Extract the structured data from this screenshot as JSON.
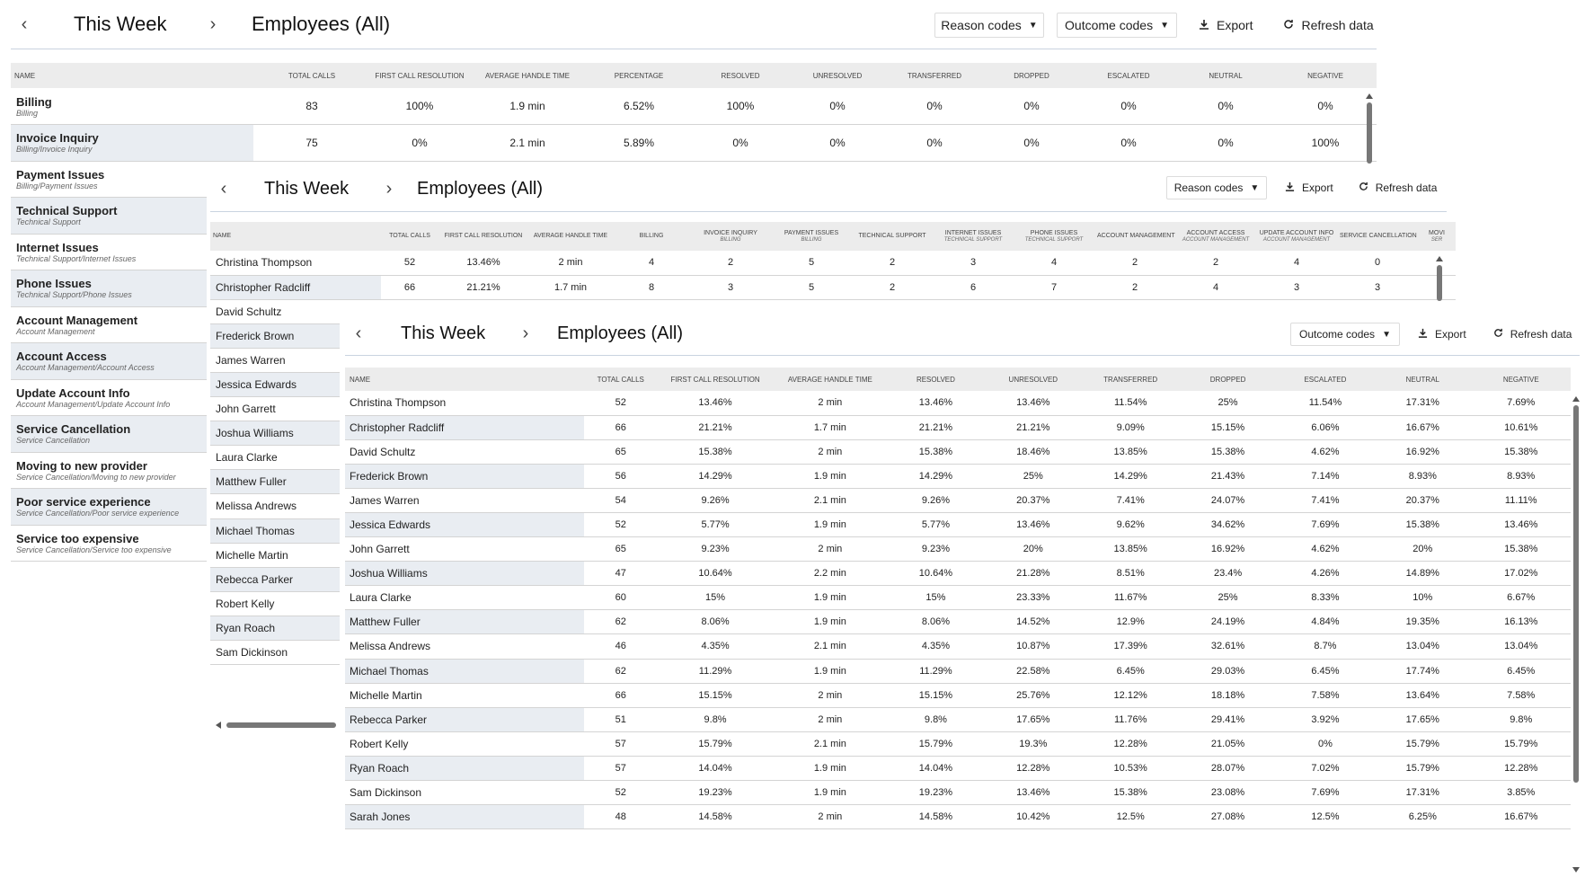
{
  "nav": {
    "prev": "‹",
    "next": "›"
  },
  "panel1": {
    "period": "This Week",
    "scope": "Employees (All)",
    "toolbar": {
      "reason_codes": "Reason codes",
      "outcome_codes": "Outcome codes",
      "export": "Export",
      "refresh": "Refresh data"
    },
    "columns": [
      "Name",
      "Total calls",
      "First call resolution",
      "Average handle time",
      "Percentage",
      "Resolved",
      "Unresolved",
      "Transferred",
      "Dropped",
      "Escalated",
      "Neutral",
      "Negative"
    ],
    "rows": [
      {
        "name": "Billing",
        "path": "Billing",
        "cells": [
          "83",
          "100%",
          "1.9 min",
          "6.52%",
          "100%",
          "0%",
          "0%",
          "0%",
          "0%",
          "0%",
          "0%"
        ]
      },
      {
        "name": "Invoice Inquiry",
        "path": "Billing/Invoice Inquiry",
        "cells": [
          "75",
          "0%",
          "2.1 min",
          "5.89%",
          "0%",
          "0%",
          "0%",
          "0%",
          "0%",
          "0%",
          "100%"
        ]
      },
      {
        "name": "Payment Issues",
        "path": "Billing/Payment Issues",
        "cells": []
      },
      {
        "name": "Technical Support",
        "path": "Technical Support",
        "cells": []
      },
      {
        "name": "Internet Issues",
        "path": "Technical Support/Internet Issues",
        "cells": []
      },
      {
        "name": "Phone Issues",
        "path": "Technical Support/Phone Issues",
        "cells": []
      },
      {
        "name": "Account Management",
        "path": "Account Management",
        "cells": []
      },
      {
        "name": "Account Access",
        "path": "Account Management/Account Access",
        "cells": []
      },
      {
        "name": "Update Account Info",
        "path": "Account Management/Update Account Info",
        "cells": []
      },
      {
        "name": "Service Cancellation",
        "path": "Service Cancellation",
        "cells": []
      },
      {
        "name": "Moving to new provider",
        "path": "Service Cancellation/Moving to new provider",
        "cells": []
      },
      {
        "name": "Poor service experience",
        "path": "Service Cancellation/Poor service experience",
        "cells": []
      },
      {
        "name": "Service too expensive",
        "path": "Service Cancellation/Service too expensive",
        "cells": []
      }
    ]
  },
  "panel2": {
    "period": "This Week",
    "scope": "Employees (All)",
    "toolbar": {
      "reason_codes": "Reason codes",
      "export": "Export",
      "refresh": "Refresh data"
    },
    "columns": [
      {
        "label": "Name",
        "sub": ""
      },
      {
        "label": "Total calls",
        "sub": ""
      },
      {
        "label": "First call resolution",
        "sub": ""
      },
      {
        "label": "Average handle time",
        "sub": ""
      },
      {
        "label": "Billing",
        "sub": ""
      },
      {
        "label": "Invoice Inquiry",
        "sub": "Billing"
      },
      {
        "label": "Payment Issues",
        "sub": "Billing"
      },
      {
        "label": "Technical Support",
        "sub": ""
      },
      {
        "label": "Internet Issues",
        "sub": "Technical Support"
      },
      {
        "label": "Phone Issues",
        "sub": "Technical Support"
      },
      {
        "label": "Account Management",
        "sub": ""
      },
      {
        "label": "Account Access",
        "sub": "Account Management"
      },
      {
        "label": "Update Account Info",
        "sub": "Account Management"
      },
      {
        "label": "Service Cancellation",
        "sub": ""
      },
      {
        "label": "Movi",
        "sub": "Ser"
      }
    ],
    "rows": [
      {
        "name": "Christina Thompson",
        "cells": [
          "52",
          "13.46%",
          "2 min",
          "4",
          "2",
          "5",
          "2",
          "3",
          "4",
          "2",
          "2",
          "4",
          "0",
          ""
        ]
      },
      {
        "name": "Christopher Radcliff",
        "cells": [
          "66",
          "21.21%",
          "1.7 min",
          "8",
          "3",
          "5",
          "2",
          "6",
          "7",
          "2",
          "4",
          "3",
          "3",
          ""
        ]
      },
      {
        "name": "David Schultz",
        "cells": []
      },
      {
        "name": "Frederick Brown",
        "cells": []
      },
      {
        "name": "James Warren",
        "cells": []
      },
      {
        "name": "Jessica Edwards",
        "cells": []
      },
      {
        "name": "John Garrett",
        "cells": []
      },
      {
        "name": "Joshua Williams",
        "cells": []
      },
      {
        "name": "Laura Clarke",
        "cells": []
      },
      {
        "name": "Matthew Fuller",
        "cells": []
      },
      {
        "name": "Melissa Andrews",
        "cells": []
      },
      {
        "name": "Michael Thomas",
        "cells": []
      },
      {
        "name": "Michelle Martin",
        "cells": []
      },
      {
        "name": "Rebecca Parker",
        "cells": []
      },
      {
        "name": "Robert Kelly",
        "cells": []
      },
      {
        "name": "Ryan Roach",
        "cells": []
      },
      {
        "name": "Sam Dickinson",
        "cells": []
      }
    ]
  },
  "panel3": {
    "period": "This Week",
    "scope": "Employees (All)",
    "toolbar": {
      "outcome_codes": "Outcome codes",
      "export": "Export",
      "refresh": "Refresh data"
    },
    "columns": [
      "Name",
      "Total calls",
      "First call resolution",
      "Average handle time",
      "Resolved",
      "Unresolved",
      "Transferred",
      "Dropped",
      "Escalated",
      "Neutral",
      "Negative"
    ],
    "rows": [
      {
        "name": "Christina Thompson",
        "cells": [
          "52",
          "13.46%",
          "2 min",
          "13.46%",
          "13.46%",
          "11.54%",
          "25%",
          "11.54%",
          "17.31%",
          "7.69%"
        ]
      },
      {
        "name": "Christopher Radcliff",
        "cells": [
          "66",
          "21.21%",
          "1.7 min",
          "21.21%",
          "21.21%",
          "9.09%",
          "15.15%",
          "6.06%",
          "16.67%",
          "10.61%"
        ]
      },
      {
        "name": "David Schultz",
        "cells": [
          "65",
          "15.38%",
          "2 min",
          "15.38%",
          "18.46%",
          "13.85%",
          "15.38%",
          "4.62%",
          "16.92%",
          "15.38%"
        ]
      },
      {
        "name": "Frederick Brown",
        "cells": [
          "56",
          "14.29%",
          "1.9 min",
          "14.29%",
          "25%",
          "14.29%",
          "21.43%",
          "7.14%",
          "8.93%",
          "8.93%"
        ]
      },
      {
        "name": "James Warren",
        "cells": [
          "54",
          "9.26%",
          "2.1 min",
          "9.26%",
          "20.37%",
          "7.41%",
          "24.07%",
          "7.41%",
          "20.37%",
          "11.11%"
        ]
      },
      {
        "name": "Jessica Edwards",
        "cells": [
          "52",
          "5.77%",
          "1.9 min",
          "5.77%",
          "13.46%",
          "9.62%",
          "34.62%",
          "7.69%",
          "15.38%",
          "13.46%"
        ]
      },
      {
        "name": "John Garrett",
        "cells": [
          "65",
          "9.23%",
          "2 min",
          "9.23%",
          "20%",
          "13.85%",
          "16.92%",
          "4.62%",
          "20%",
          "15.38%"
        ]
      },
      {
        "name": "Joshua Williams",
        "cells": [
          "47",
          "10.64%",
          "2.2 min",
          "10.64%",
          "21.28%",
          "8.51%",
          "23.4%",
          "4.26%",
          "14.89%",
          "17.02%"
        ]
      },
      {
        "name": "Laura Clarke",
        "cells": [
          "60",
          "15%",
          "1.9 min",
          "15%",
          "23.33%",
          "11.67%",
          "25%",
          "8.33%",
          "10%",
          "6.67%"
        ]
      },
      {
        "name": "Matthew Fuller",
        "cells": [
          "62",
          "8.06%",
          "1.9 min",
          "8.06%",
          "14.52%",
          "12.9%",
          "24.19%",
          "4.84%",
          "19.35%",
          "16.13%"
        ]
      },
      {
        "name": "Melissa Andrews",
        "cells": [
          "46",
          "4.35%",
          "2.1 min",
          "4.35%",
          "10.87%",
          "17.39%",
          "32.61%",
          "8.7%",
          "13.04%",
          "13.04%"
        ]
      },
      {
        "name": "Michael Thomas",
        "cells": [
          "62",
          "11.29%",
          "1.9 min",
          "11.29%",
          "22.58%",
          "6.45%",
          "29.03%",
          "6.45%",
          "17.74%",
          "6.45%"
        ]
      },
      {
        "name": "Michelle Martin",
        "cells": [
          "66",
          "15.15%",
          "2 min",
          "15.15%",
          "25.76%",
          "12.12%",
          "18.18%",
          "7.58%",
          "13.64%",
          "7.58%"
        ]
      },
      {
        "name": "Rebecca Parker",
        "cells": [
          "51",
          "9.8%",
          "2 min",
          "9.8%",
          "17.65%",
          "11.76%",
          "29.41%",
          "3.92%",
          "17.65%",
          "9.8%"
        ]
      },
      {
        "name": "Robert Kelly",
        "cells": [
          "57",
          "15.79%",
          "2.1 min",
          "15.79%",
          "19.3%",
          "12.28%",
          "21.05%",
          "0%",
          "15.79%",
          "15.79%"
        ]
      },
      {
        "name": "Ryan Roach",
        "cells": [
          "57",
          "14.04%",
          "1.9 min",
          "14.04%",
          "12.28%",
          "10.53%",
          "28.07%",
          "7.02%",
          "15.79%",
          "12.28%"
        ]
      },
      {
        "name": "Sam Dickinson",
        "cells": [
          "52",
          "19.23%",
          "1.9 min",
          "19.23%",
          "13.46%",
          "15.38%",
          "23.08%",
          "7.69%",
          "17.31%",
          "3.85%"
        ]
      },
      {
        "name": "Sarah Jones",
        "cells": [
          "48",
          "14.58%",
          "2 min",
          "14.58%",
          "10.42%",
          "12.5%",
          "27.08%",
          "12.5%",
          "6.25%",
          "16.67%"
        ]
      }
    ]
  }
}
